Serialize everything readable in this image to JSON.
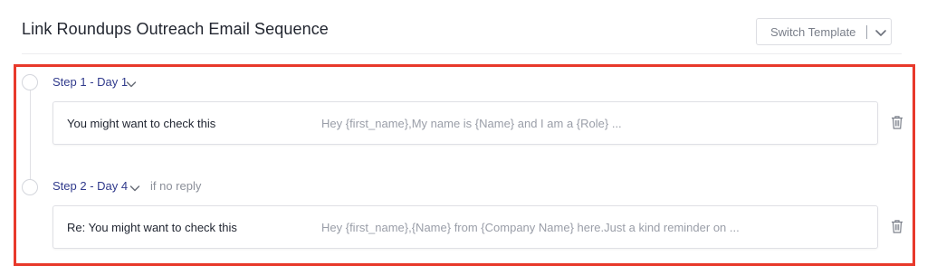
{
  "header": {
    "title": "Link Roundups Outreach Email Sequence",
    "switch_template_label": "Switch Template"
  },
  "steps": [
    {
      "title": "Step 1 - Day 1",
      "condition": "",
      "subject": "You might want to check this",
      "preview": "Hey {first_name},My name is {Name} and I am a {Role} ..."
    },
    {
      "title": "Step 2 - Day 4",
      "condition": "if no reply",
      "subject": "Re: You might want to check this",
      "preview": "Hey {first_name},{Name} from {Company Name} here.Just a kind reminder on ..."
    }
  ],
  "icons": {
    "dropdown": "chevron-down-icon",
    "delete": "trash-icon",
    "step_marker": "circle-icon"
  },
  "colors": {
    "step_title": "#303a8c",
    "highlight_border": "#e8392b",
    "muted_text": "#9a9ea8"
  }
}
